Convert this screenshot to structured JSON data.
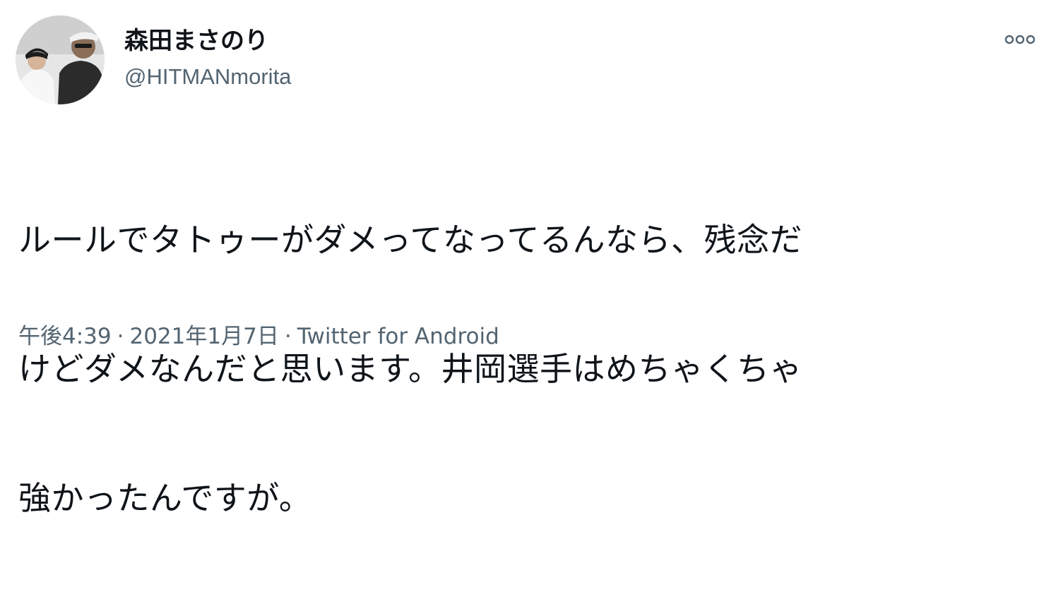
{
  "tweet": {
    "author": {
      "display_name": "森田まさのり",
      "handle": "@HITMANmorita"
    },
    "text_lines": [
      "ルールでタトゥーがダメってなってるんなら、残念だ",
      "けどダメなんだと思います。井岡選手はめちゃくちゃ",
      "強かったんですが。"
    ],
    "meta": {
      "time": "午後4:39",
      "separator": "·",
      "date": "2021年1月7日",
      "source": "Twitter for Android"
    }
  },
  "icons": {
    "avatar": "user-avatar-photo",
    "more": "more-options-icon"
  },
  "colors": {
    "text_primary": "#0f1419",
    "text_secondary": "#536471",
    "background": "#ffffff"
  }
}
